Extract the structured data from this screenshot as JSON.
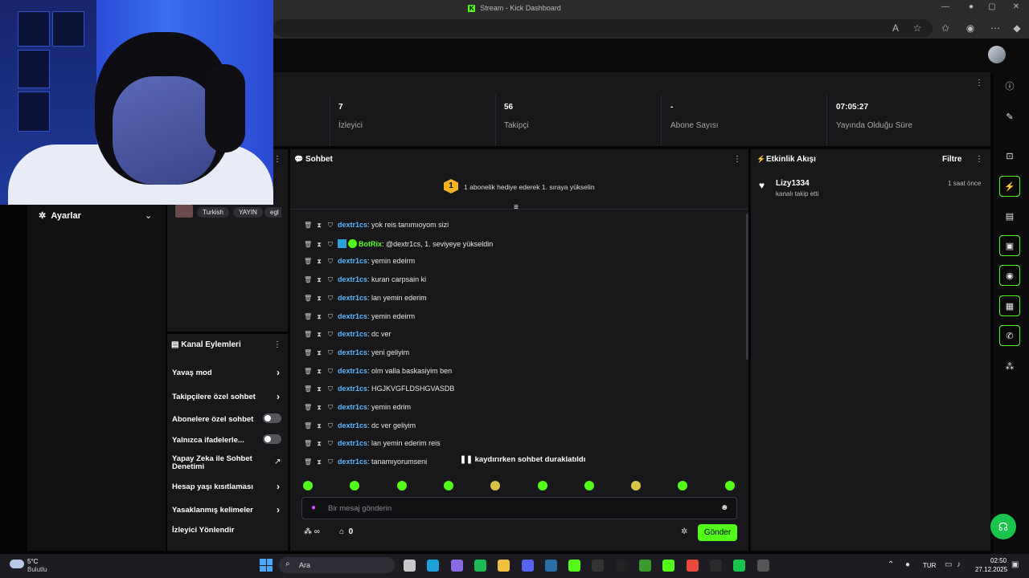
{
  "browser": {
    "title": "Stream - Kick Dashboard",
    "tab_logo": "K"
  },
  "stats": [
    {
      "value": "7",
      "label": "İzleyici"
    },
    {
      "value": "56",
      "label": "Takipçi"
    },
    {
      "value": "-",
      "label": "Abone Sayısı"
    },
    {
      "value": "07:05:27",
      "label": "Yayında Olduğu Süre"
    }
  ],
  "sidebar": {
    "settings_label": "Ayarlar"
  },
  "stream_info": {
    "tags": [
      "Turkish",
      "YAYIN",
      "egl"
    ]
  },
  "channel_actions": {
    "title": "Kanal Eylemleri",
    "items": [
      {
        "label": "Yavaş mod",
        "control": "chevron"
      },
      {
        "label": "Takipçilere özel sohbet",
        "control": "chevron"
      },
      {
        "label": "Abonelere özel sohbet",
        "control": "toggle",
        "value": false
      },
      {
        "label": "Yalnızca ifadelerle...",
        "control": "toggle",
        "value": false
      },
      {
        "label": "Yapay Zeka ile Sohbet Denetimi",
        "control": "external"
      },
      {
        "label": "Hesap yaşı kısıtlaması",
        "control": "chevron"
      },
      {
        "label": "Yasaklanmış kelimeler",
        "control": "chevron"
      },
      {
        "label": "İzleyici Yönlendir",
        "control": "none"
      }
    ]
  },
  "chat": {
    "title": "Sohbet",
    "gift_badge": "1",
    "gift_text": "1 abonelik hediye ederek 1. sıraya yükselin",
    "messages": [
      {
        "user": "dextr1cs",
        "text": "yok reis tanımıoyom sizi"
      },
      {
        "user": "BotRix",
        "text": "@dextr1cs, 1. seviyeye yükseldin",
        "bot": true
      },
      {
        "user": "dextr1cs",
        "text": "yemin edeirm"
      },
      {
        "user": "dextr1cs",
        "text": "kuran carpsain ki"
      },
      {
        "user": "dextr1cs",
        "text": "lan yemin ederim"
      },
      {
        "user": "dextr1cs",
        "text": "yemin edeirm"
      },
      {
        "user": "dextr1cs",
        "text": "dc ver"
      },
      {
        "user": "dextr1cs",
        "text": "yeni geliyim"
      },
      {
        "user": "dextr1cs",
        "text": "olm valla baskasiyim ben"
      },
      {
        "user": "dextr1cs",
        "text": "HGJKVGFLDSHGVASDB"
      },
      {
        "user": "dextr1cs",
        "text": "yemin edrim"
      },
      {
        "user": "dextr1cs",
        "text": "dc ver geliyim"
      },
      {
        "user": "dextr1cs",
        "text": "lan yemin ederim reis"
      },
      {
        "user": "dextr1cs",
        "text": "tanamıyorumseni"
      }
    ],
    "paused_text": "kaydırırken sohbet duraklatıldı",
    "input_placeholder": "Bir mesaj gönderin",
    "points": "∞",
    "shop_count": "0",
    "send_label": "Gönder"
  },
  "activity": {
    "title": "Etkinlik Akışı",
    "filter_label": "Filtre",
    "events": [
      {
        "user": "Lizy1334",
        "text": "kanalı takip etti",
        "time": "1 saat önce"
      }
    ]
  },
  "taskbar": {
    "weather_temp": "5°C",
    "weather_desc": "Bulutlu",
    "search_label": "Ara",
    "language": "TUR",
    "time": "02:50",
    "date": "27.12.2025"
  },
  "colors": {
    "accent": "#53fc18",
    "username": "#5bb5ff",
    "gift": "#f5b321"
  }
}
